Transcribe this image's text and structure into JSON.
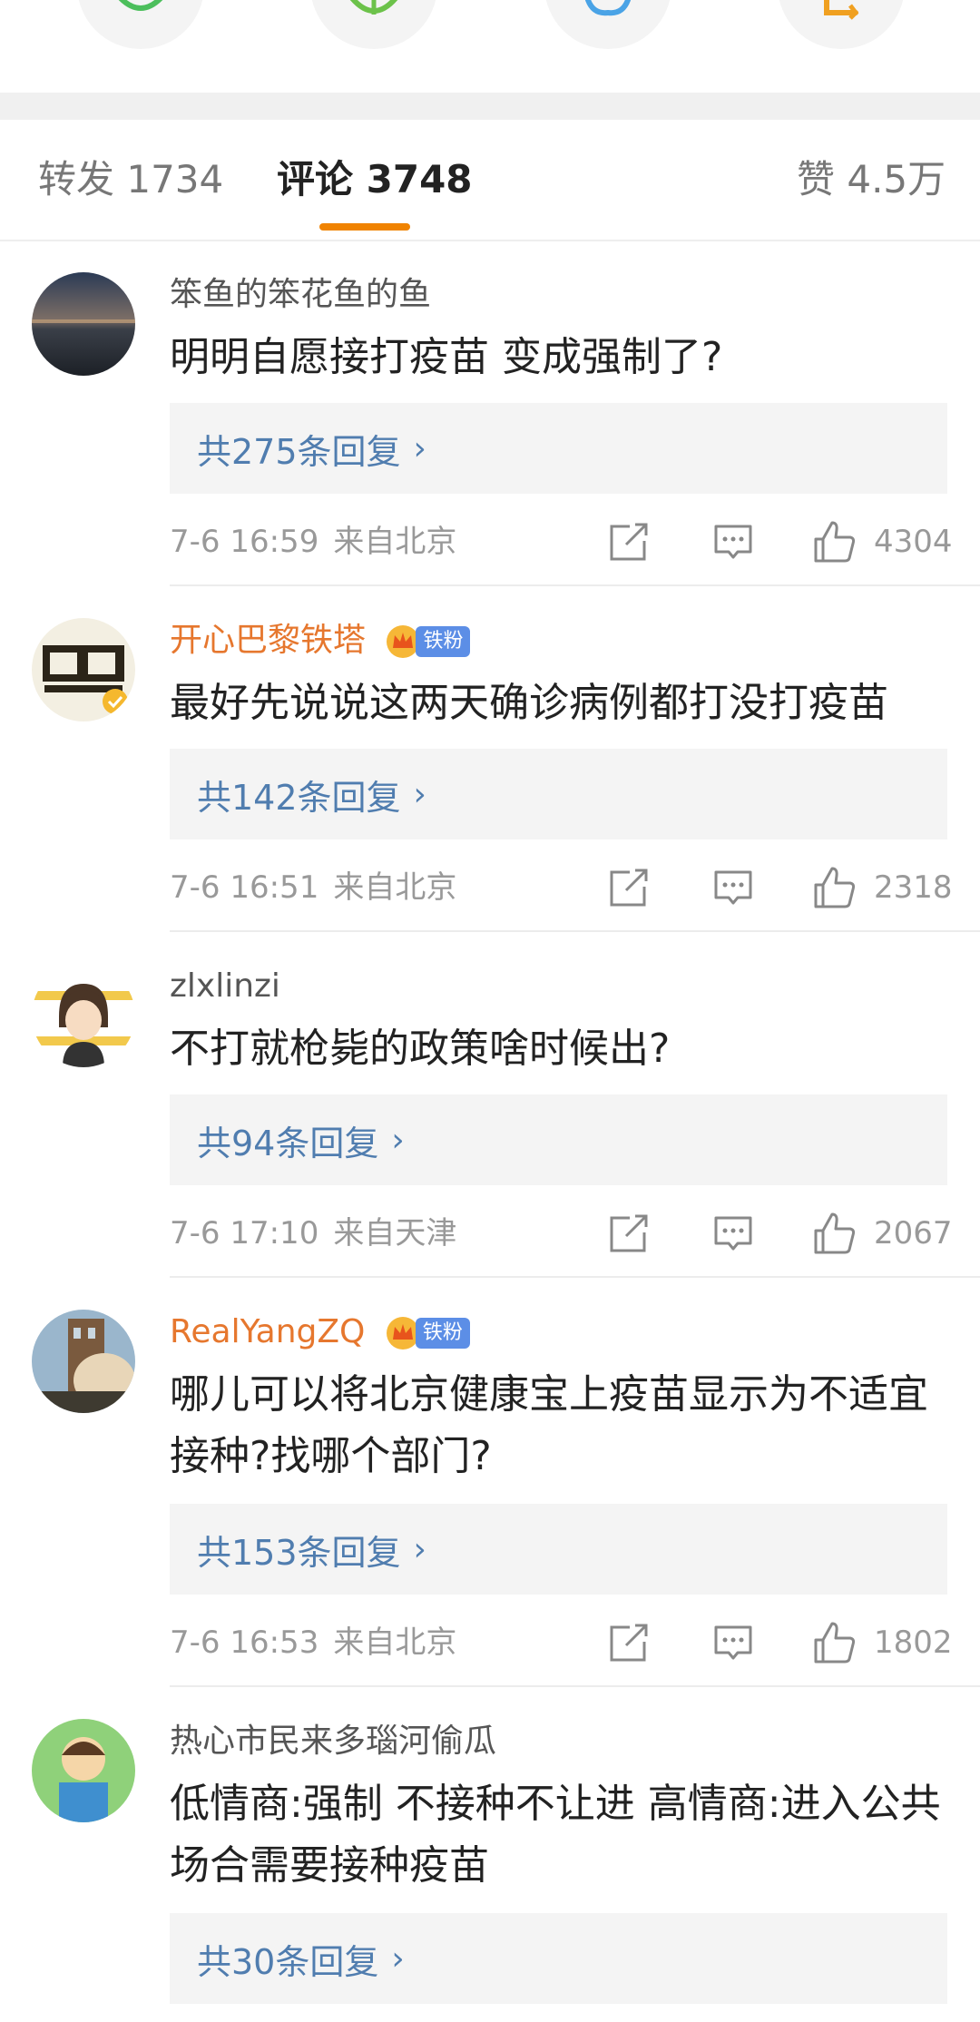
{
  "tabs": {
    "repost": "转发 1734",
    "comments": "评论 3748",
    "likes": "赞 4.5万"
  },
  "comments": [
    {
      "username": "笨鱼的笨花鱼的鱼",
      "text": "明明自愿接打疫苗 变成强制了?",
      "replies": "共275条回复",
      "time": "7-6 16:59",
      "source": "来自北京",
      "likes": "4304"
    },
    {
      "username": "开心巴黎铁塔",
      "badge": "铁粉",
      "text": "最好先说说这两天确诊病例都打没打疫苗",
      "replies": "共142条回复",
      "time": "7-6 16:51",
      "source": "来自北京",
      "likes": "2318"
    },
    {
      "username": "zlxlinzi",
      "text": "不打就枪毙的政策啥时候出?",
      "replies": "共94条回复",
      "time": "7-6 17:10",
      "source": "来自天津",
      "likes": "2067"
    },
    {
      "username": "RealYangZQ",
      "badge": "铁粉",
      "text": "哪儿可以将北京健康宝上疫苗显示为不适宜接种?找哪个部门?",
      "replies": "共153条回复",
      "time": "7-6 16:53",
      "source": "来自北京",
      "likes": "1802"
    },
    {
      "username": "热心市民来多瑙河偷瓜",
      "text": "低情商:强制 不接种不让进 高情商:进入公共场合需要接种疫苗",
      "replies": "共30条回复"
    }
  ],
  "icons": {
    "share": "share-icon",
    "reply": "comment-icon",
    "like": "thumbs-up-icon",
    "chevron": "chevron-right-icon"
  },
  "colors": {
    "accent": "#f08300",
    "link": "#507daf",
    "vip_name": "#e6772e",
    "fan_badge": "#5c8ee6"
  }
}
